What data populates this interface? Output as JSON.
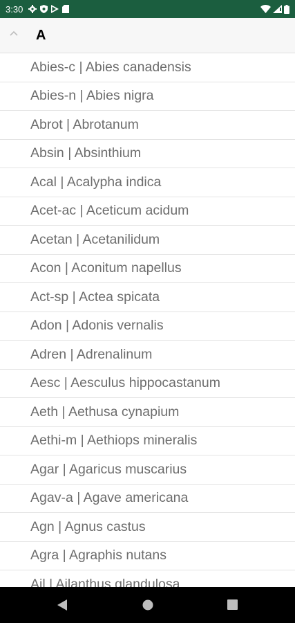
{
  "status_bar": {
    "time": "3:30",
    "icons": [
      "settings-icon",
      "shield-icon",
      "play-store-icon",
      "sd-card-icon",
      "wifi-icon",
      "signal-icon",
      "battery-icon"
    ],
    "color": "#1b5e3f"
  },
  "section": {
    "letter": "A"
  },
  "remedies": [
    "Abies-c | Abies canadensis",
    "Abies-n | Abies nigra",
    "Abrot | Abrotanum",
    "Absin | Absinthium",
    "Acal | Acalypha indica",
    "Acet-ac | Aceticum acidum",
    "Acetan | Acetanilidum",
    "Acon | Aconitum napellus",
    "Act-sp | Actea spicata",
    "Adon | Adonis vernalis",
    "Adren | Adrenalinum",
    "Aesc | Aesculus hippocastanum",
    "Aeth | Aethusa cynapium",
    "Aethi-m | Aethiops mineralis",
    "Agar | Agaricus muscarius",
    "Agav-a | Agave americana",
    "Agn | Agnus castus",
    "Agra | Agraphis nutans",
    "Ail | Ailanthus glandulosa"
  ],
  "nav_bar": {
    "icons": [
      "back-icon",
      "home-icon",
      "recent-apps-icon"
    ]
  }
}
